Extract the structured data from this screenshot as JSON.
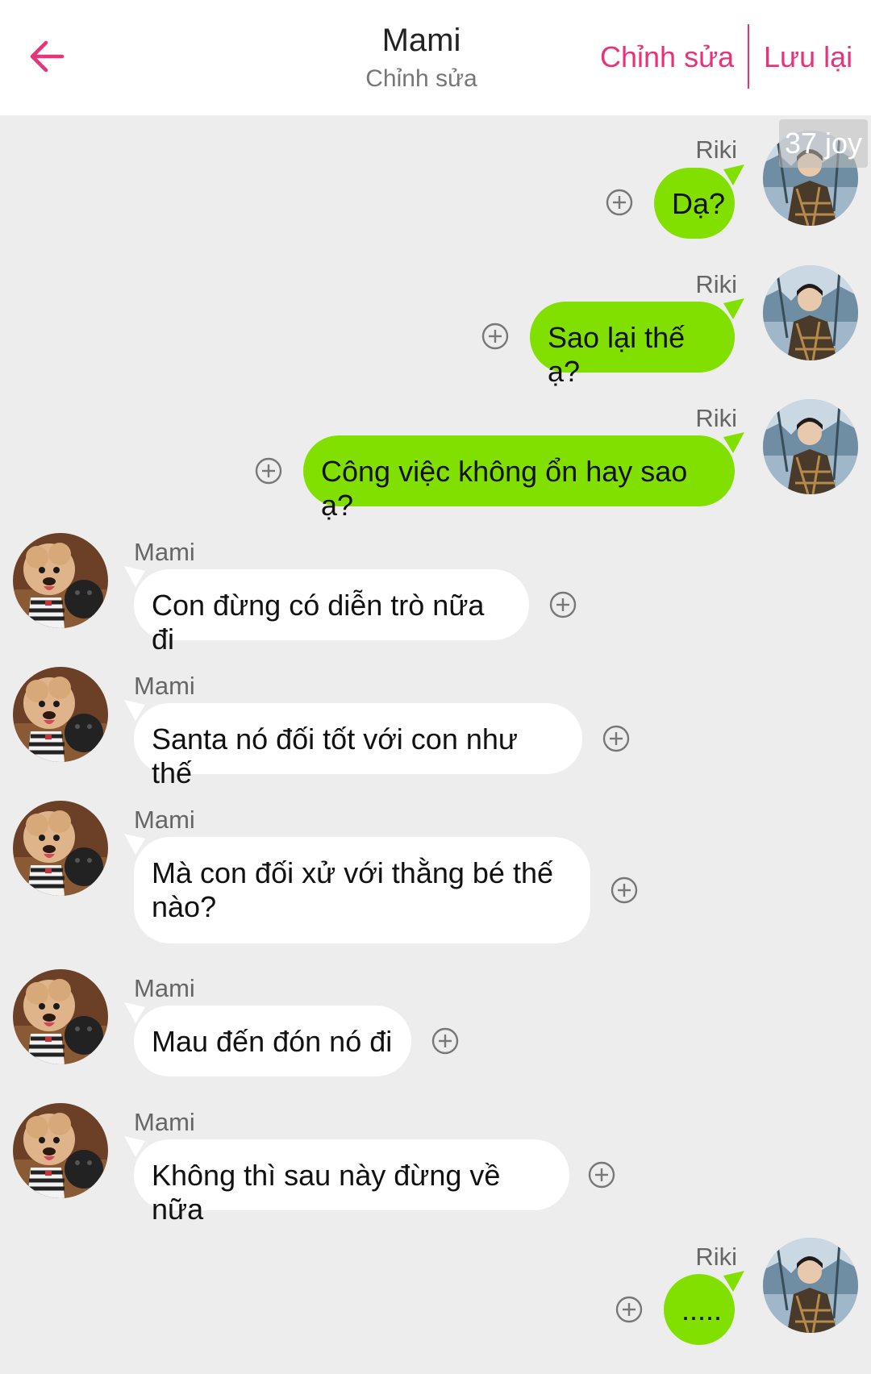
{
  "header": {
    "title": "Mami",
    "subtitle": "Chỉnh sửa",
    "edit_label": "Chỉnh sửa",
    "save_label": "Lưu lại",
    "back_icon": "arrow-left-icon",
    "accent_color": "#e6337a"
  },
  "watermark": "37 joy",
  "colors": {
    "outgoing_bubble": "#82e000",
    "incoming_bubble": "#ffffff",
    "background": "#ededed"
  },
  "messages": [
    {
      "sender": "Riki",
      "text": "Dạ?"
    },
    {
      "sender": "Riki",
      "text": "Sao lại thế ạ?"
    },
    {
      "sender": "Riki",
      "text": "Công việc không ổn hay sao ạ?"
    },
    {
      "sender": "Mami",
      "text": "Con đừng có diễn trò nữa đi"
    },
    {
      "sender": "Mami",
      "text": "Santa nó đối tốt với con như thế"
    },
    {
      "sender": "Mami",
      "text": "Mà con đối xử với thằng bé thế nào?"
    },
    {
      "sender": "Mami",
      "text": "Mau đến đón nó đi"
    },
    {
      "sender": "Mami",
      "text": "Không thì sau này đừng về nữa"
    },
    {
      "sender": "Riki",
      "text": "....."
    }
  ]
}
